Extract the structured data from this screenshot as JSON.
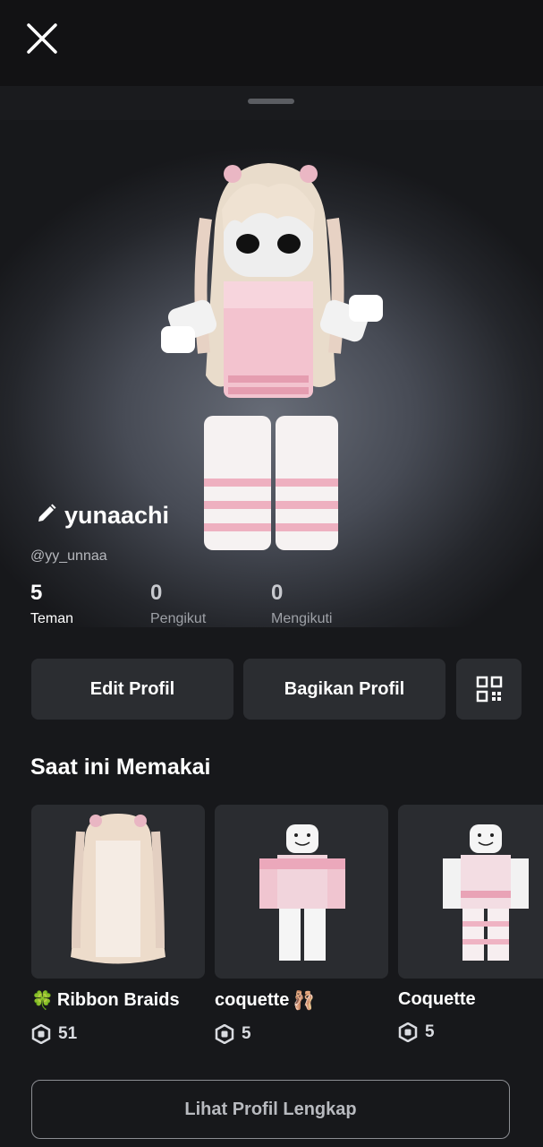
{
  "header": {
    "close_icon": "close-icon"
  },
  "profile": {
    "display_name": "yunaachi",
    "username": "@yy_unnaa",
    "edit_icon": "pencil-icon"
  },
  "stats": [
    {
      "value": "5",
      "label": "Teman"
    },
    {
      "value": "0",
      "label": "Pengikut"
    },
    {
      "value": "0",
      "label": "Mengikuti"
    }
  ],
  "actions": {
    "edit_label": "Edit Profil",
    "share_label": "Bagikan Profil",
    "qr_icon": "qr-code-icon"
  },
  "wearing": {
    "title": "Saat ini Memakai",
    "items": [
      {
        "prefix": "🍀",
        "name": "Ribbon Braids",
        "suffix": "",
        "price": "51"
      },
      {
        "prefix": "",
        "name": "coquette",
        "suffix": "🩰",
        "price": "5"
      },
      {
        "prefix": "",
        "name": "Coquette",
        "suffix": "",
        "price": "5"
      }
    ]
  },
  "footer": {
    "full_profile_label": "Lihat Profil Lengkap"
  },
  "colors": {
    "background": "#111214",
    "button": "#2b2d31",
    "accent_pink": "#f0b6c6"
  }
}
